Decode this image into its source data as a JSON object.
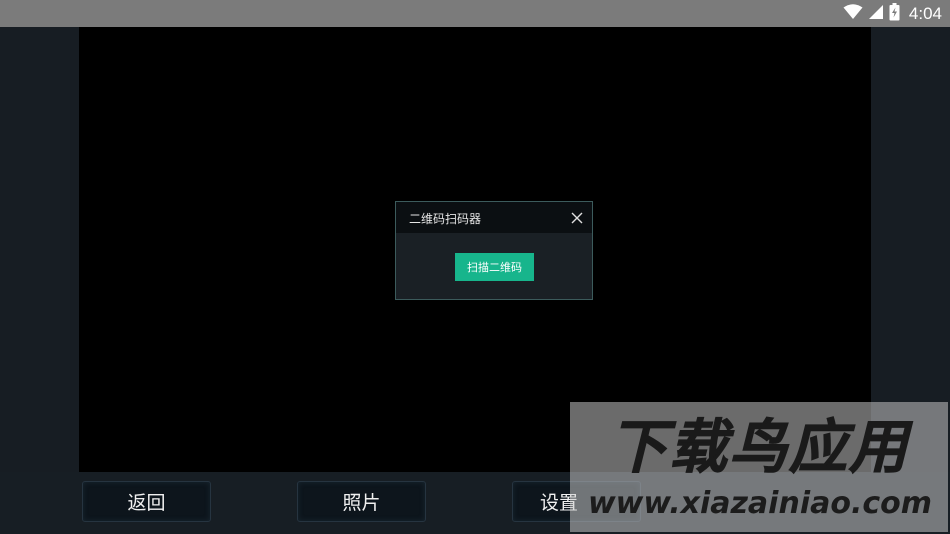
{
  "status_bar": {
    "time": "4:04",
    "icons": [
      "wifi-icon",
      "signal-icon",
      "battery-charging-icon"
    ]
  },
  "dialog": {
    "title": "二维码扫码器",
    "scan_button_label": "扫描二维码",
    "close_icon": "close-icon"
  },
  "bottom_bar": {
    "buttons": [
      {
        "label": "返回"
      },
      {
        "label": "照片"
      },
      {
        "label": "设置"
      }
    ]
  },
  "watermark": {
    "title": "下载鸟应用",
    "url": "www.xiazainiao.com"
  },
  "colors": {
    "status_bar": "#7b7b7b",
    "camera_view": "#000000",
    "accent": "#17b58c",
    "dialog_border": "#3c5b5c",
    "background": "#171d23"
  }
}
